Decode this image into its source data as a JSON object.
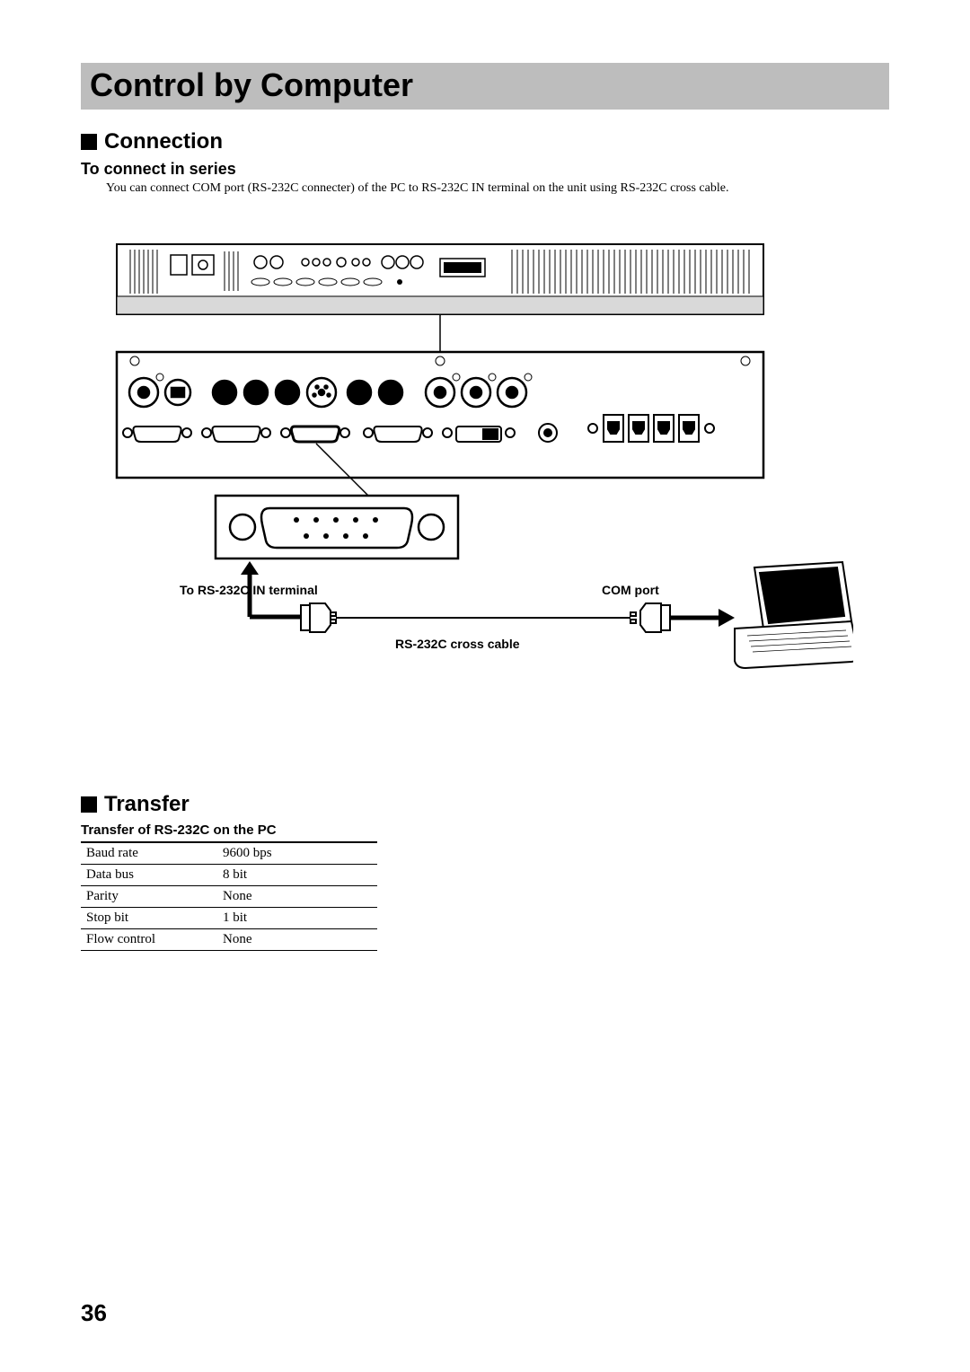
{
  "page_title": "Control by Computer",
  "section_connection": "Connection",
  "sub_connect_series": "To connect in series",
  "body_connect_series": "You can connect COM port (RS-232C connecter) of the PC to RS-232C IN terminal on the unit using RS-232C cross cable.",
  "diagram": {
    "label_in_terminal": "To RS-232C IN terminal",
    "label_com_port": "COM port",
    "label_cable": "RS-232C cross cable"
  },
  "section_transfer": "Transfer",
  "table_title": "Transfer of RS-232C on the PC",
  "table_rows": [
    {
      "param": "Baud rate",
      "value": "9600 bps"
    },
    {
      "param": "Data bus",
      "value": "8 bit"
    },
    {
      "param": "Parity",
      "value": "None"
    },
    {
      "param": "Stop bit",
      "value": "1 bit"
    },
    {
      "param": "Flow control",
      "value": "None"
    }
  ],
  "page_number": "36"
}
